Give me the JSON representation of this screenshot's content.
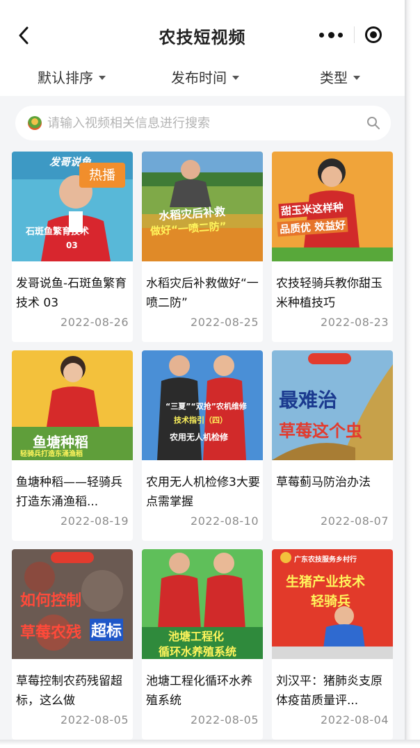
{
  "nav": {
    "title": "农技短视频",
    "back_icon": "back-chevron-icon",
    "more_icon": "more-dots-icon",
    "close_icon": "target-close-icon"
  },
  "filters": [
    {
      "label": "默认排序"
    },
    {
      "label": "发布时间"
    },
    {
      "label": "类型"
    }
  ],
  "search": {
    "placeholder": "请输入视频相关信息进行搜索",
    "value": "",
    "icon": "search-icon"
  },
  "videos": [
    {
      "title": "发哥说鱼-石斑鱼繁育技术 03",
      "date": "2022-08-26",
      "badge": "热播",
      "thumb_text": [
        "发哥说鱼",
        "石斑鱼繁育技术",
        "03"
      ]
    },
    {
      "title": "水稻灾后补救做好“一喷二防”",
      "date": "2022-08-25",
      "thumb_text": [
        "水稻灾后补救",
        "做好“一喷二防”"
      ]
    },
    {
      "title": "农技轻骑兵教你甜玉米种植技巧",
      "date": "2022-08-23",
      "thumb_text": [
        "甜玉米这样种",
        "品质优 效益好"
      ]
    },
    {
      "title": "鱼塘种稻——轻骑兵打造东涌渔稻...",
      "date": "2022-08-19",
      "thumb_text": [
        "鱼塘种稻",
        "轻骑兵打造东涌渔稻"
      ]
    },
    {
      "title": "农用无人机检修3大要点需掌握",
      "date": "2022-08-10",
      "thumb_text": [
        "“三夏”“双抢”农机维修",
        "技术指引（四）",
        "农用无人机检修"
      ]
    },
    {
      "title": "草莓蓟马防治办法",
      "date": "2022-08-07",
      "thumb_text": [
        "最难治",
        "草莓这个虫"
      ]
    },
    {
      "title": "草莓控制农药残留超标，这么做",
      "date": "2022-08-05",
      "thumb_text": [
        "如何控制",
        "草莓农残",
        "超标"
      ]
    },
    {
      "title": "池塘工程化循环水养殖系统",
      "date": "2022-08-05",
      "thumb_text": [
        "池塘工程化",
        "循环水养殖系统"
      ]
    },
    {
      "title": "刘汉平：猪肺炎支原体疫苗质量评...",
      "date": "2022-08-04",
      "thumb_text": [
        "广东农技服务乡村行",
        "生猪产业技术",
        "轻骑兵"
      ]
    }
  ],
  "colors": {
    "accent_orange": "#f18e2c",
    "page_bg": "#f4f5f7",
    "date_gray": "#8c8c8c"
  }
}
